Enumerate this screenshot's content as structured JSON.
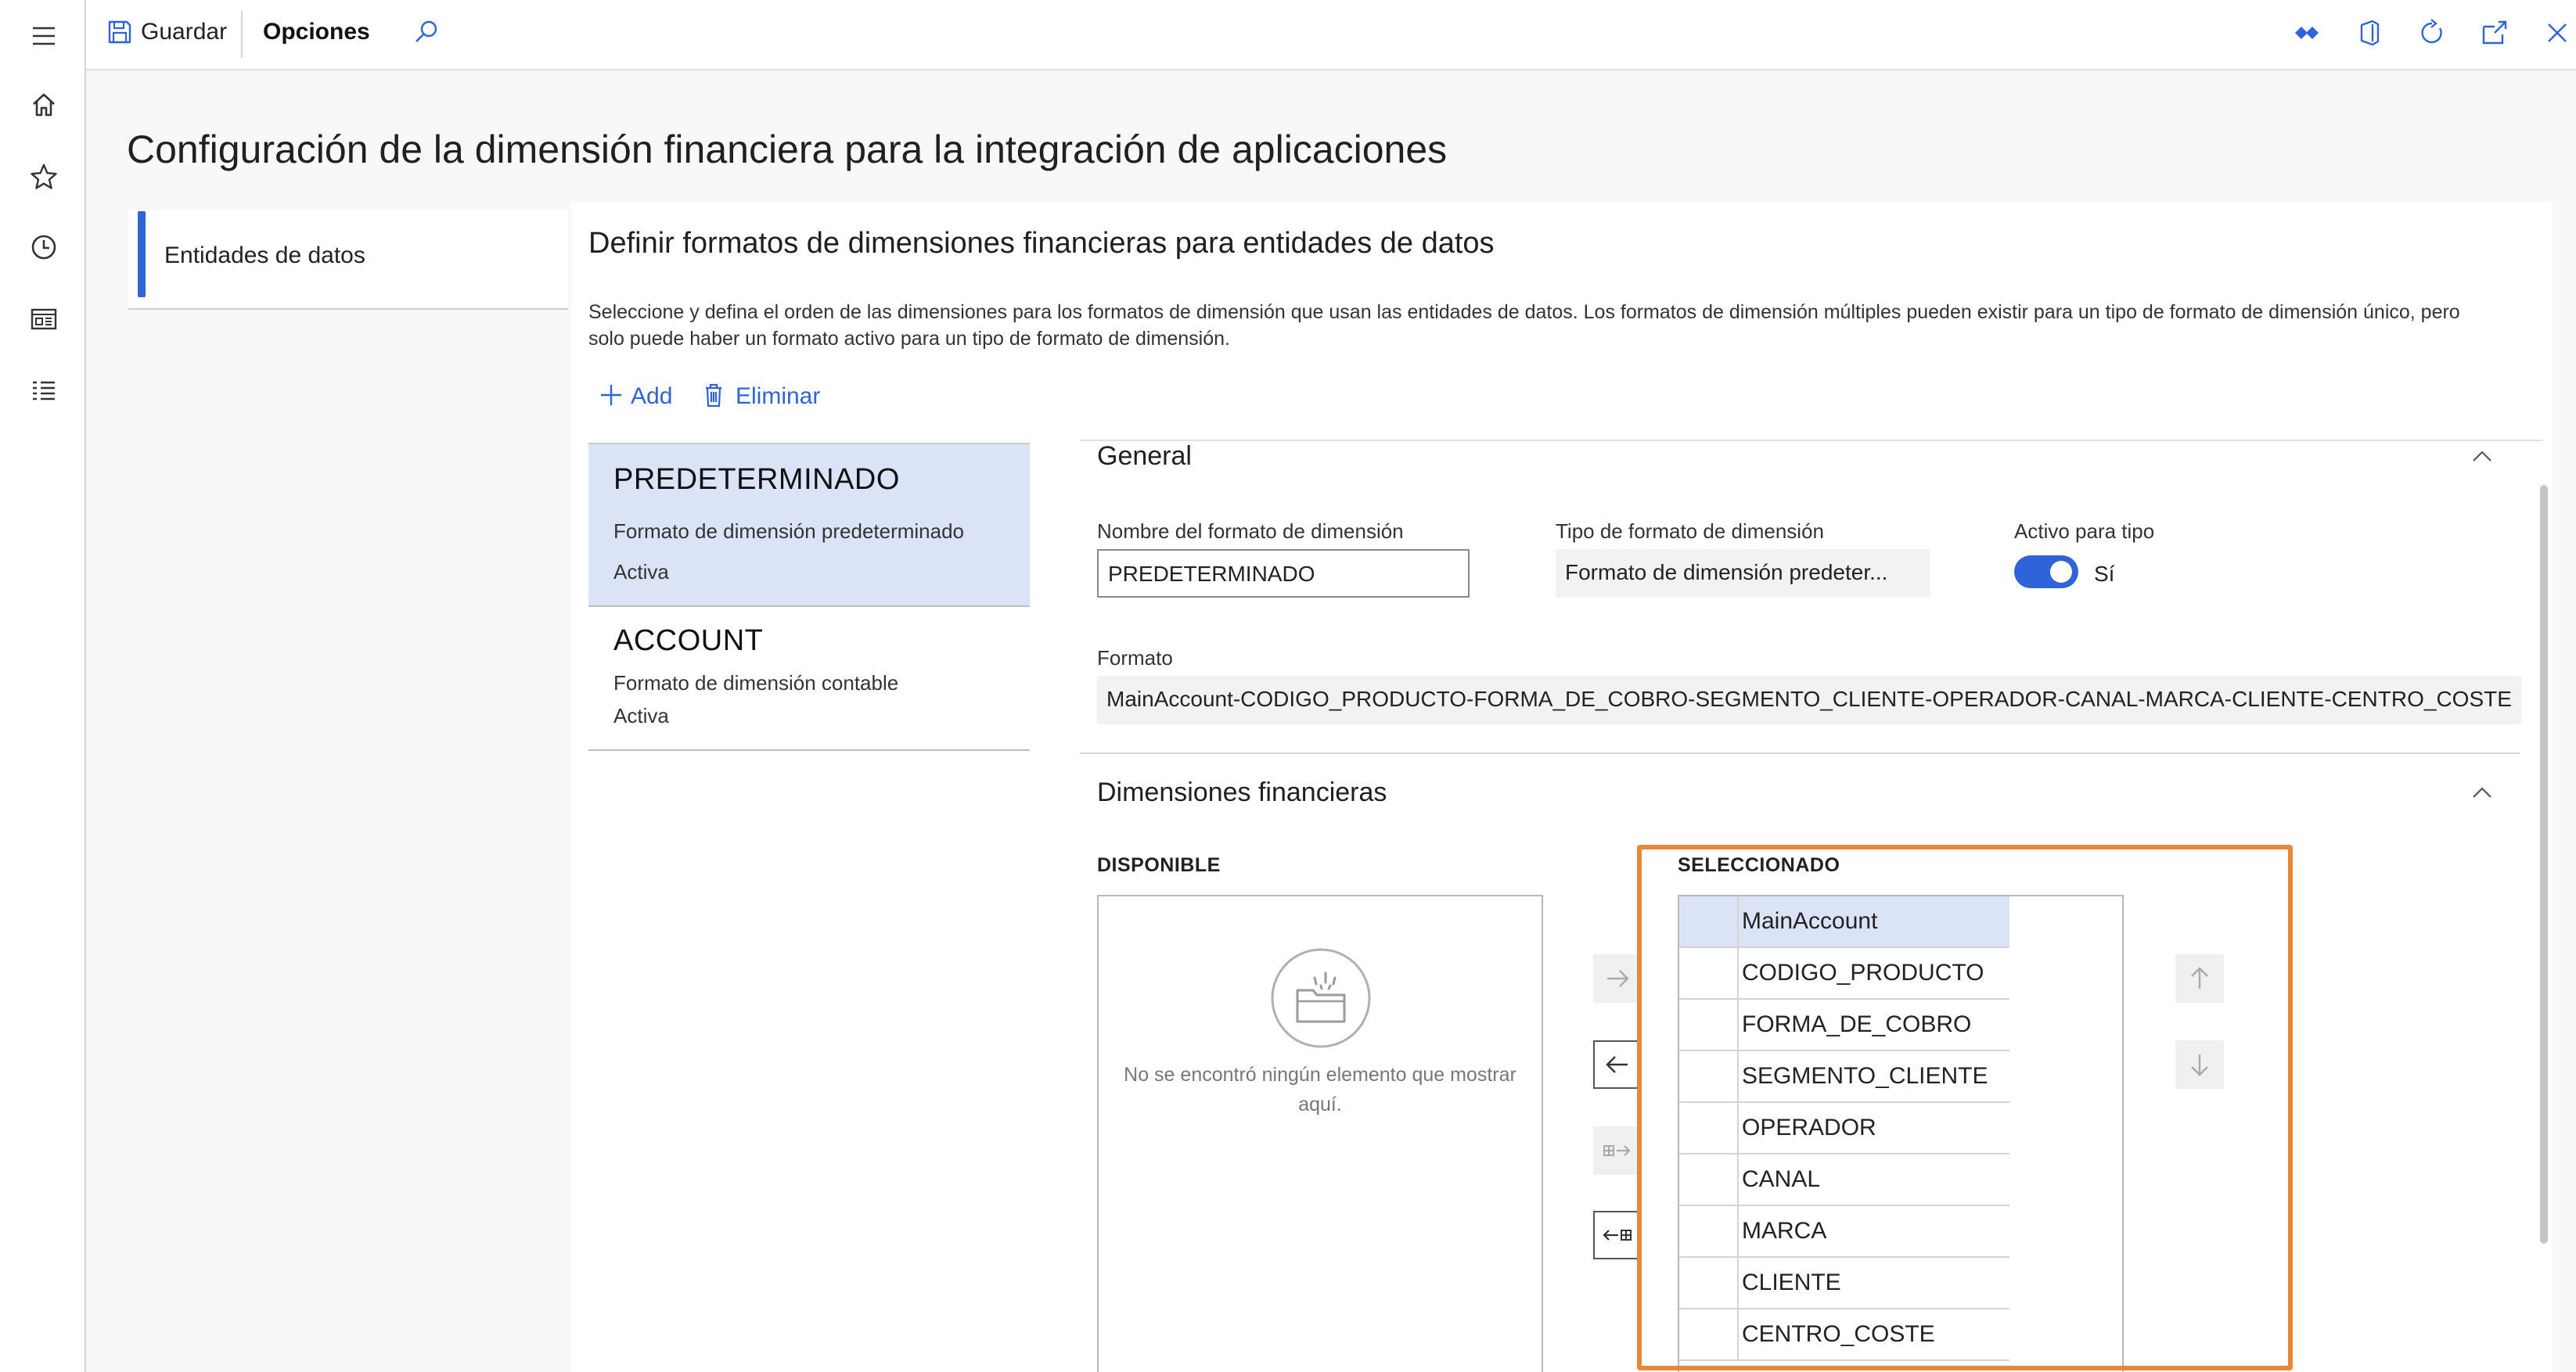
{
  "toolbar": {
    "save_label": "Guardar",
    "options_label": "Opciones"
  },
  "page": {
    "title": "Configuración de la dimensión financiera para la integración de aplicaciones"
  },
  "tabs": {
    "data_entities": "Entidades de datos"
  },
  "section": {
    "heading": "Definir formatos de dimensiones financieras para entidades de datos",
    "description_line1": "Seleccione y defina el orden de las dimensiones para los formatos de dimensión que usan las entidades de datos. Los formatos de dimensión múltiples pueden existir para un tipo de formato de dimensión único, pero",
    "description_line2": "solo puede haber un formato activo para un tipo de formato de dimensión.",
    "add_label": "Add",
    "delete_label": "Eliminar"
  },
  "formats": [
    {
      "name": "PREDETERMINADO",
      "description": "Formato de dimensión predeterminado",
      "status": "Activa"
    },
    {
      "name": "ACCOUNT",
      "description": "Formato de dimensión contable",
      "status": "Activa"
    }
  ],
  "general": {
    "heading": "General",
    "name_label": "Nombre del formato de dimensión",
    "name_value": "PREDETERMINADO",
    "type_label": "Tipo de formato de dimensión",
    "type_value": "Formato de dimensión predeter...",
    "active_label": "Activo para tipo",
    "active_value": "Sí",
    "format_label": "Formato",
    "format_value": "MainAccount-CODIGO_PRODUCTO-FORMA_DE_COBRO-SEGMENTO_CLIENTE-OPERADOR-CANAL-MARCA-CLIENTE-CENTRO_COSTE"
  },
  "dimensions": {
    "heading": "Dimensiones financieras",
    "available_label": "DISPONIBLE",
    "selected_label": "SELECCIONADO",
    "empty_message_line1": "No se encontró ningún elemento que mostrar",
    "empty_message_line2": "aquí.",
    "selected_items": [
      "MainAccount",
      "CODIGO_PRODUCTO",
      "FORMA_DE_COBRO",
      "SEGMENTO_CLIENTE",
      "OPERADOR",
      "CANAL",
      "MARCA",
      "CLIENTE",
      "CENTRO_COSTE"
    ]
  },
  "colors": {
    "accent": "#2f64d9",
    "selected_bg": "#dbe4f7",
    "highlight_border": "#e8893a"
  }
}
